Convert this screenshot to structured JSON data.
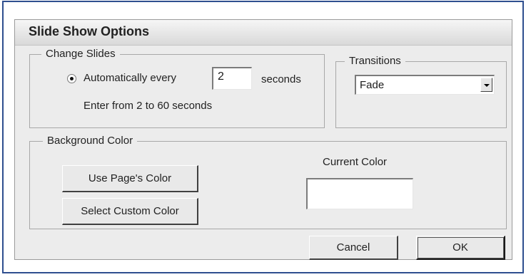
{
  "dialog": {
    "title": "Slide Show Options"
  },
  "change_slides": {
    "legend": "Change Slides",
    "auto_label": "Automatically every",
    "interval_value": "2",
    "seconds_label": "seconds",
    "hint": "Enter from 2 to 60 seconds",
    "auto_selected": true
  },
  "transitions": {
    "legend": "Transitions",
    "selected": "Fade"
  },
  "background_color": {
    "legend": "Background Color",
    "use_page_color_label": "Use Page's Color",
    "select_custom_color_label": "Select Custom Color",
    "current_color_label": "Current Color",
    "current_color_value": "#ffffff"
  },
  "footer": {
    "cancel_label": "Cancel",
    "ok_label": "OK"
  }
}
